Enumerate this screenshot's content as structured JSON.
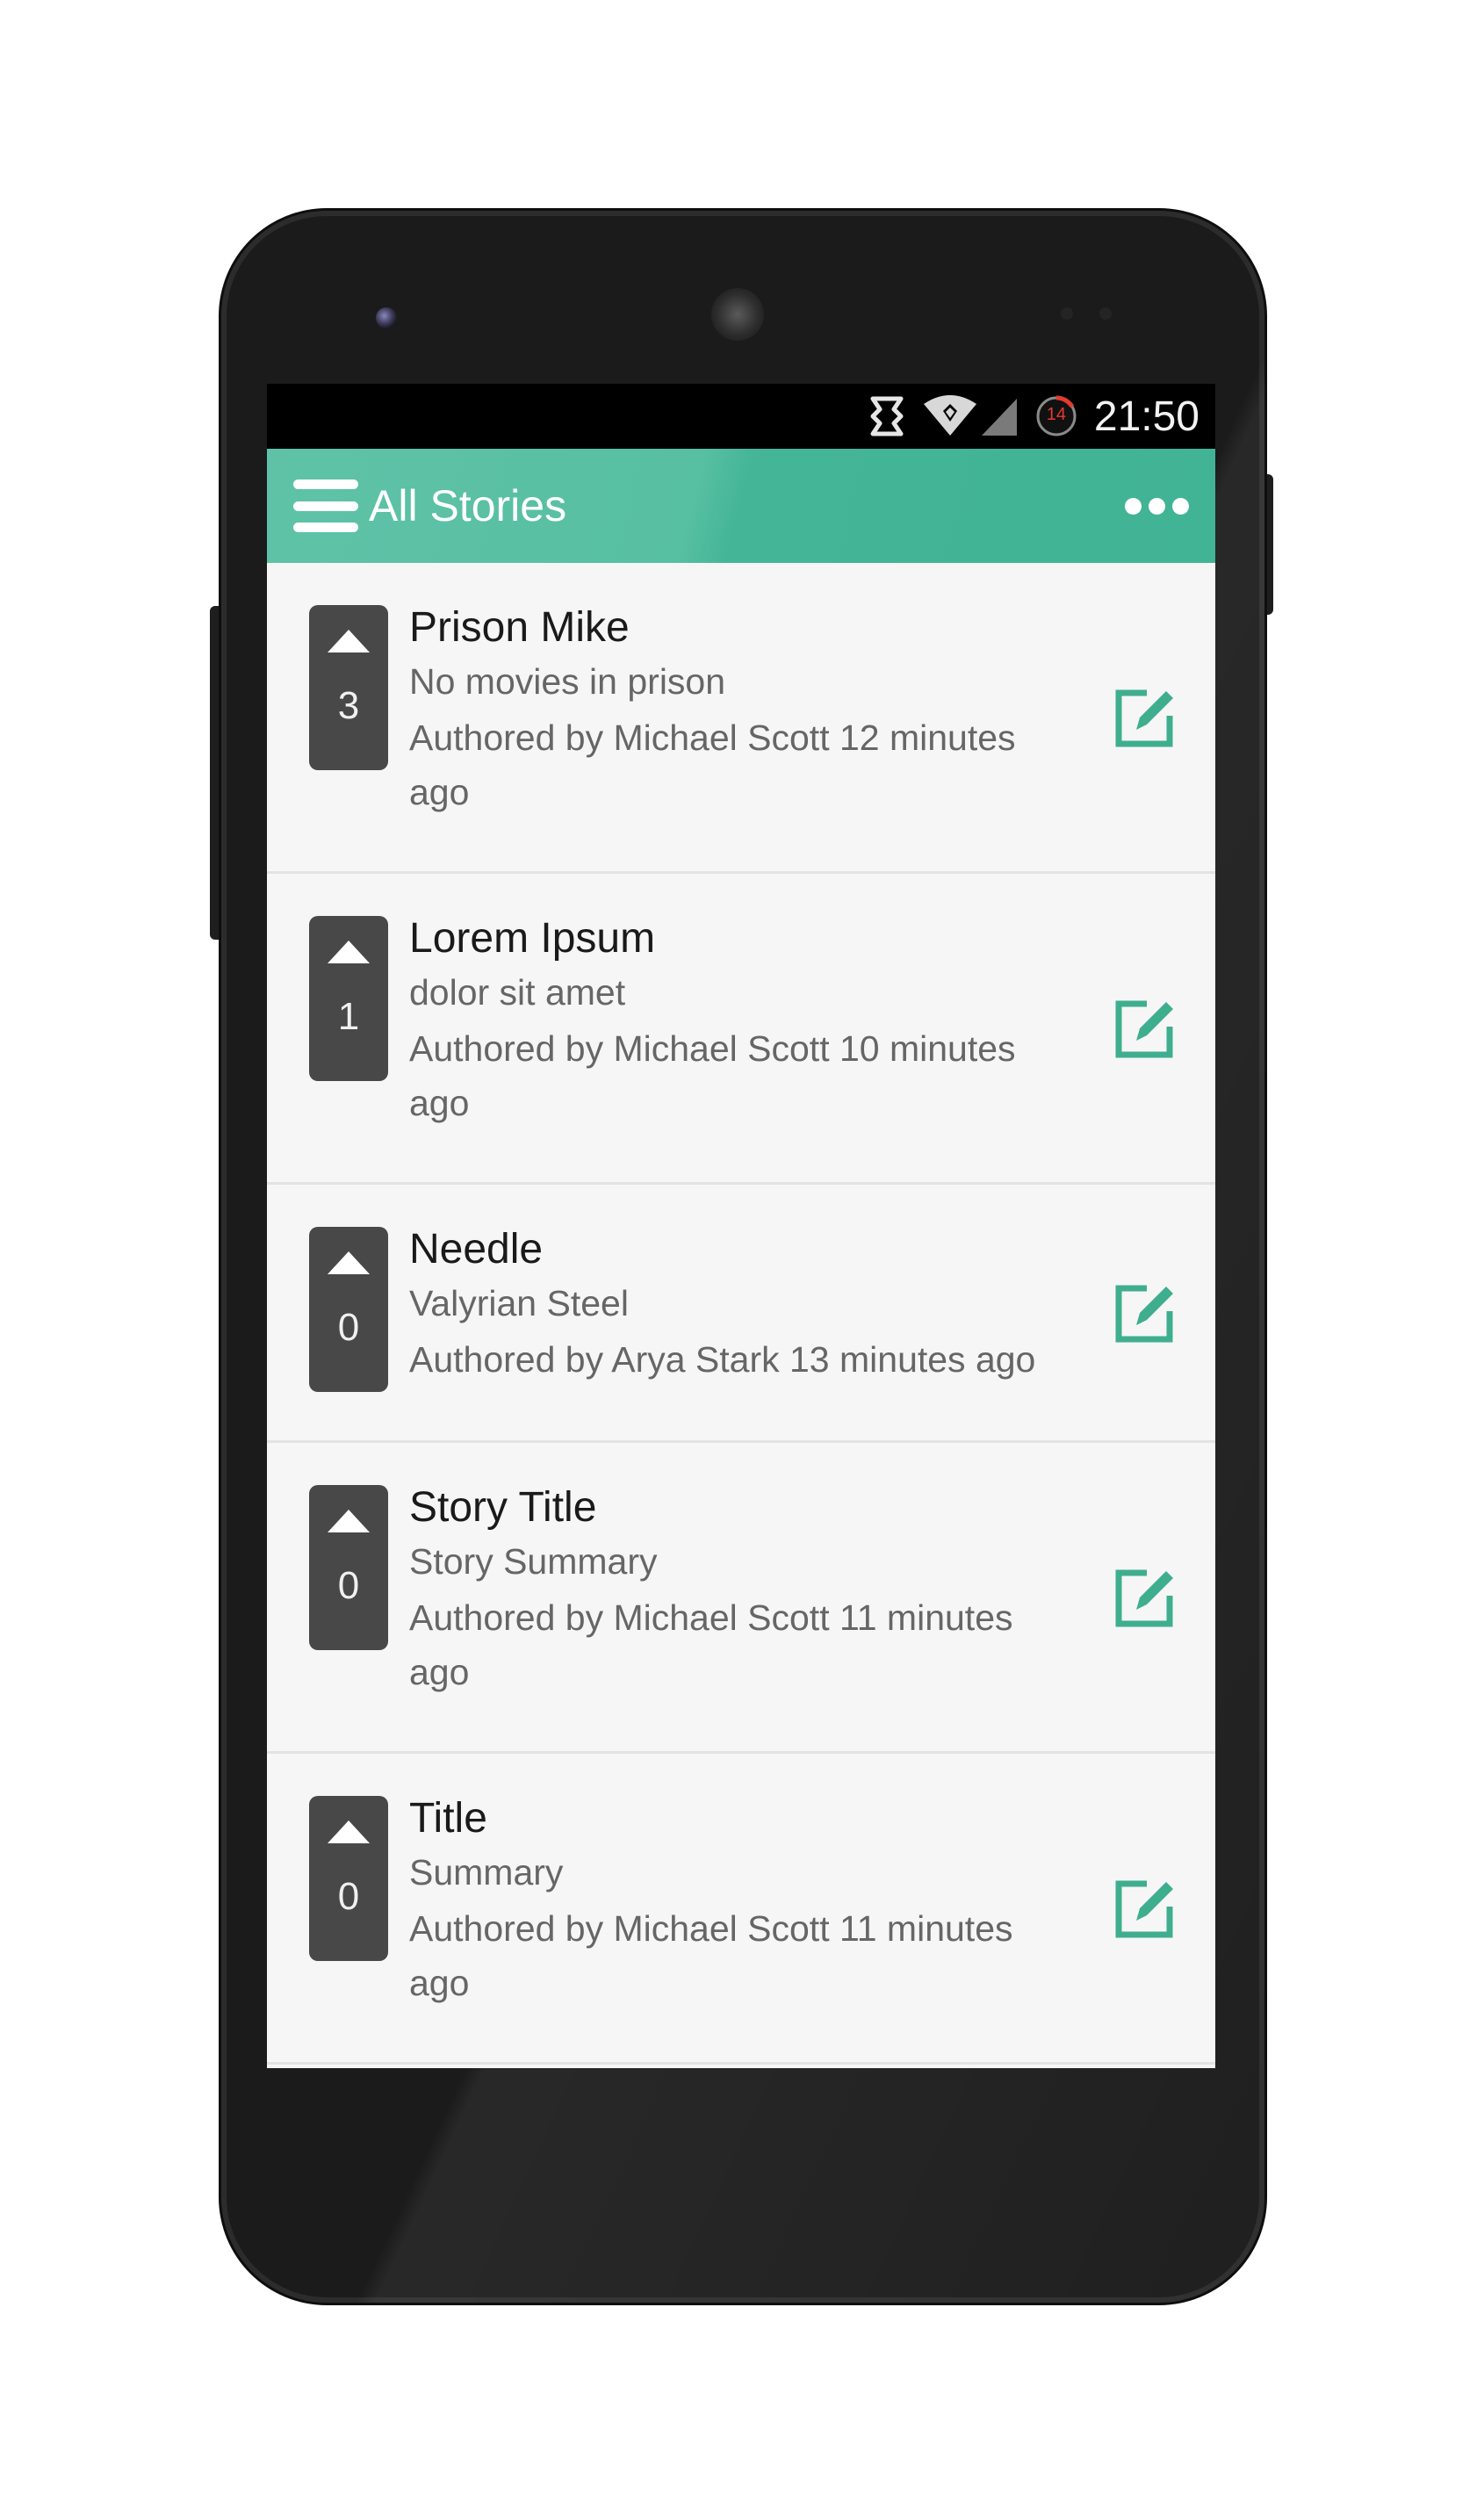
{
  "statusbar": {
    "time": "21:50",
    "battery_level": "14",
    "icons": [
      "notification-icon",
      "wifi-icon",
      "signal-icon",
      "battery-icon"
    ]
  },
  "appbar": {
    "title": "All Stories",
    "menu_icon": "hamburger-menu-icon",
    "overflow_icon": "more-horiz-icon"
  },
  "colors": {
    "accent": "#41b495",
    "vote_box": "#484848",
    "edit_icon": "#3fae8f"
  },
  "stories": [
    {
      "votes": "3",
      "title": "Prison Mike",
      "summary": "No movies in prison",
      "meta_line1": "Authored by Michael Scott 12 minutes",
      "meta_line2": "ago"
    },
    {
      "votes": "1",
      "title": "Lorem Ipsum",
      "summary": "dolor sit amet",
      "meta_line1": "Authored by Michael Scott 10 minutes",
      "meta_line2": "ago"
    },
    {
      "votes": "0",
      "title": "Needle",
      "summary": "Valyrian Steel",
      "meta_line1": "Authored by Arya Stark 13 minutes ago",
      "meta_line2": ""
    },
    {
      "votes": "0",
      "title": "Story Title",
      "summary": "Story Summary",
      "meta_line1": "Authored by Michael Scott 11 minutes",
      "meta_line2": "ago"
    },
    {
      "votes": "0",
      "title": "Title",
      "summary": "Summary",
      "meta_line1": "Authored by Michael Scott 11 minutes",
      "meta_line2": "ago"
    }
  ]
}
